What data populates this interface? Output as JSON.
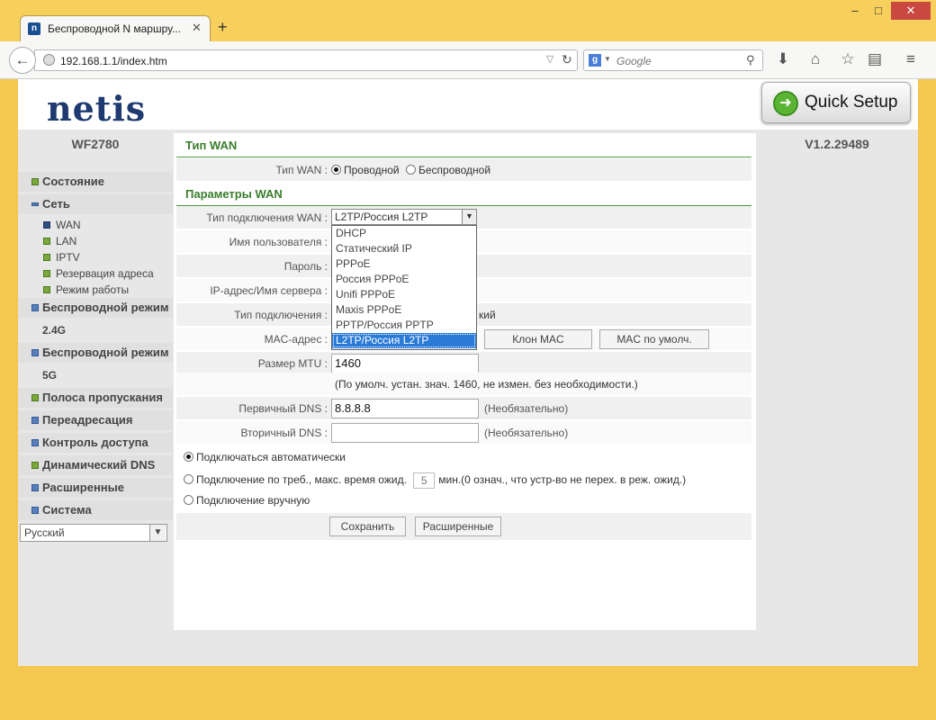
{
  "browser": {
    "tab_title": "Беспроводной N маршру...",
    "tab_close": "✕",
    "new_tab": "+",
    "win_min": "–",
    "win_max": "□",
    "win_close": "✕",
    "url": "192.168.1.1/index.htm",
    "search_placeholder": "Google",
    "icons": [
      "back-arrow-icon",
      "reload-icon",
      "search-icon",
      "download-icon",
      "home-icon",
      "bookmark-star-icon",
      "reading-list-icon",
      "menu-icon"
    ]
  },
  "header": {
    "logo": "netis",
    "quick_setup": "Quick Setup",
    "model": "WF2780",
    "version": "V1.2.29489"
  },
  "sidebar": {
    "items": [
      {
        "label": "Состояние"
      },
      {
        "label": "Сеть"
      },
      {
        "label": "Беспроводной режим"
      },
      {
        "label": "2.4G"
      },
      {
        "label": "Беспроводной режим"
      },
      {
        "label": "5G"
      },
      {
        "label": "Полоса пропускания"
      },
      {
        "label": "Переадресация"
      },
      {
        "label": "Контроль доступа"
      },
      {
        "label": "Динамический DNS"
      },
      {
        "label": "Расширенные"
      },
      {
        "label": "Система"
      }
    ],
    "sub_items": [
      {
        "label": "WAN"
      },
      {
        "label": "LAN"
      },
      {
        "label": "IPTV"
      },
      {
        "label": "Резервация адреса"
      },
      {
        "label": "Режим работы"
      }
    ],
    "language": "Русский"
  },
  "main": {
    "section_wan_type": "Тип WAN",
    "wan_type_label": "Тип WAN :",
    "wan_type_wired": "Проводной",
    "wan_type_wireless": "Беспроводной",
    "section_wan_params": "Параметры WAN",
    "conn_type_label": "Тип подключения WAN :",
    "conn_type_value": "L2TP/Россия L2TP",
    "dropdown_options": [
      "DHCP",
      "Статический IP",
      "PPPoE",
      "Россия PPPoE",
      "Unifi PPPoE",
      "Maxis PPPoE",
      "PPTP/Россия PPTP",
      "L2TP/Россия L2TP"
    ],
    "username_label": "Имя пользователя :",
    "password_label": "Пароль :",
    "server_label": "IP-адрес/Имя сервера :",
    "conn_kind_label": "Тип подключения :",
    "conn_kind_tail": "кий",
    "mac_label": "MAC-адрес :",
    "clone_mac": "Клон MAC",
    "default_mac": "MAC по умолч.",
    "mtu_label": "Размер MTU :",
    "mtu_value": "1460",
    "mtu_note": "(По умолч. устан. знач. 1460, не измен. без необходимости.)",
    "dns1_label": "Первичный DNS :",
    "dns1_value": "8.8.8.8",
    "dns1_note": "(Необязательно)",
    "dns2_label": "Вторичный DNS :",
    "dns2_value": "",
    "dns2_note": "(Необязательно)",
    "opt_auto": "Подключаться автоматически",
    "opt_demand_prefix": "Подключение по треб., макс. время ожид.",
    "opt_demand_value": "5",
    "opt_demand_suffix": "мин.(0 означ., что устр-во не перех. в реж. ожид.)",
    "opt_manual": "Подключение вручную",
    "save_button": "Сохранить",
    "advanced_button": "Расширенные"
  }
}
